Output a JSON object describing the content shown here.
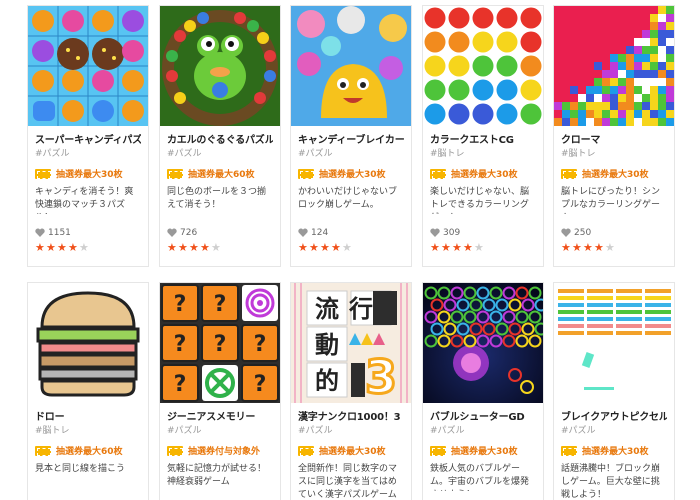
{
  "games": [
    {
      "title": "スーパーキャンディパズル",
      "category": "#パズル",
      "lottery": "抽選券最大30枚",
      "description": "キャンディを消そう！爽快連鎖のマッチ３パズル！",
      "likes": "1151",
      "rating": 4,
      "thumb_icon": "candy-puzzle-thumbnail"
    },
    {
      "title": "カエルのぐるぐるパズル",
      "category": "#パズル",
      "lottery": "抽選券最大60枚",
      "description": "同じ色のボールを３つ揃えて消そう！",
      "likes": "726",
      "rating": 4,
      "thumb_icon": "frog-ball-thumbnail"
    },
    {
      "title": "キャンディーブレイカー",
      "category": "#パズル",
      "lottery": "抽選券最大30枚",
      "description": "かわいいだけじゃないブロック崩しゲーム。",
      "likes": "124",
      "rating": 4,
      "thumb_icon": "candy-breaker-thumbnail"
    },
    {
      "title": "カラークエストCG",
      "category": "#脳トレ",
      "lottery": "抽選券最大30枚",
      "description": "楽しいだけじゃない、脳トレできるカラーリングゲーム。",
      "likes": "309",
      "rating": 4,
      "thumb_icon": "color-dots-thumbnail"
    },
    {
      "title": "クローマ",
      "category": "#脳トレ",
      "lottery": "抽選券最大30枚",
      "description": "脳トレにぴったり！シンプルなカラーリングゲーム",
      "likes": "250",
      "rating": 4,
      "thumb_icon": "chroma-pixels-thumbnail"
    },
    {
      "title": "ドロー",
      "category": "#脳トレ",
      "lottery": "抽選券最大60枚",
      "description": "見本と同じ線を描こう",
      "thumb_icon": "burger-thumbnail"
    },
    {
      "title": "ジーニアスメモリー",
      "category": "#パズル",
      "lottery": "抽選券付与対象外",
      "description": "気軽に記憶力が試せる！神経衰弱ゲーム",
      "thumb_icon": "memory-cards-thumbnail"
    },
    {
      "title": "漢字ナンクロ1000！3",
      "category": "#パズル",
      "lottery": "抽選券最大30枚",
      "description": "全問新作！同じ数字のマスに同じ漢字を当てはめていく漢字パズルゲーム第三弾",
      "thumb_icon": "kanji-grid-thumbnail",
      "kanji": [
        "流",
        "行",
        "動",
        "的"
      ],
      "kanji_num": "3"
    },
    {
      "title": "バブルシューターGD",
      "category": "#パズル",
      "lottery": "抽選券最大30枚",
      "description": "鉄板人気のバブルゲーム。宇宙のバブルを爆発させよう！",
      "thumb_icon": "bubble-shooter-thumbnail"
    },
    {
      "title": "ブレイクアウトピクセル",
      "category": "#パズル",
      "lottery": "抽選券最大30枚",
      "description": "話題沸騰中！ブロック崩しゲーム。巨大な壁に挑戦しよう！",
      "thumb_icon": "breakout-thumbnail"
    }
  ],
  "colors": {
    "accent": "#e8780c",
    "star_on": "#f0501a",
    "star_off": "#cfcfcf",
    "ticket": "#f7b500"
  }
}
